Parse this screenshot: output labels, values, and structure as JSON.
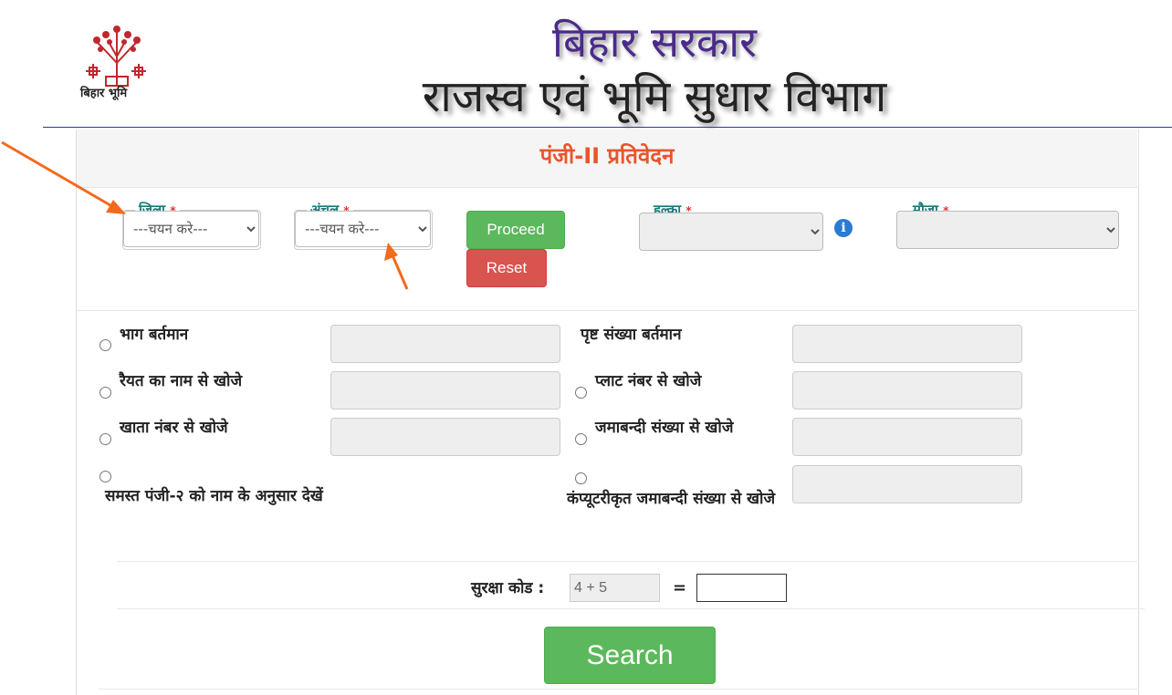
{
  "header": {
    "logo_text": "बिहार भूमि",
    "title_line1": "बिहार सरकार",
    "title_line2": "राजस्व एवं भूमि सुधार विभाग"
  },
  "panel": {
    "title": "पंजी-II प्रतिवेदन"
  },
  "filters": {
    "district_label": "जिला",
    "district_value": "---चयन करे---",
    "circle_label": "अंचल",
    "circle_value": "---चयन करे---",
    "halka_label": "हल्का",
    "halka_value": "",
    "mauja_label": "मौजा",
    "mauja_value": "",
    "required_mark": "*",
    "proceed_label": "Proceed",
    "reset_label": "Reset",
    "info_glyph": "i"
  },
  "search_options": {
    "left": [
      {
        "label": "भाग बर्तमान"
      },
      {
        "label": "रैयत का नाम से खोजे"
      },
      {
        "label": "खाता नंबर से खोजे"
      },
      {
        "label": "समस्त पंजी-२ को नाम के अनुसार देखें"
      }
    ],
    "right": [
      {
        "label": "पृष्ट संख्या बर्तमान"
      },
      {
        "label": "प्लाट नंबर से खोजे"
      },
      {
        "label": "जमाबन्दी संख्या से खोजे"
      },
      {
        "label": "कंप्यूटरीकृत जमाबन्दी संख्या से खोजे"
      }
    ]
  },
  "captcha": {
    "label": "सुरक्षा कोड :",
    "question": "4 + 5",
    "equals": "=",
    "answer": ""
  },
  "search_label": "Search",
  "colors": {
    "title_purple": "#4a2a8a",
    "panel_title_orange": "#e8562a",
    "legend_teal": "#1a7a7a",
    "btn_green": "#5cb85c",
    "btn_red": "#d9534f",
    "arrow_orange": "#f26a1b"
  }
}
